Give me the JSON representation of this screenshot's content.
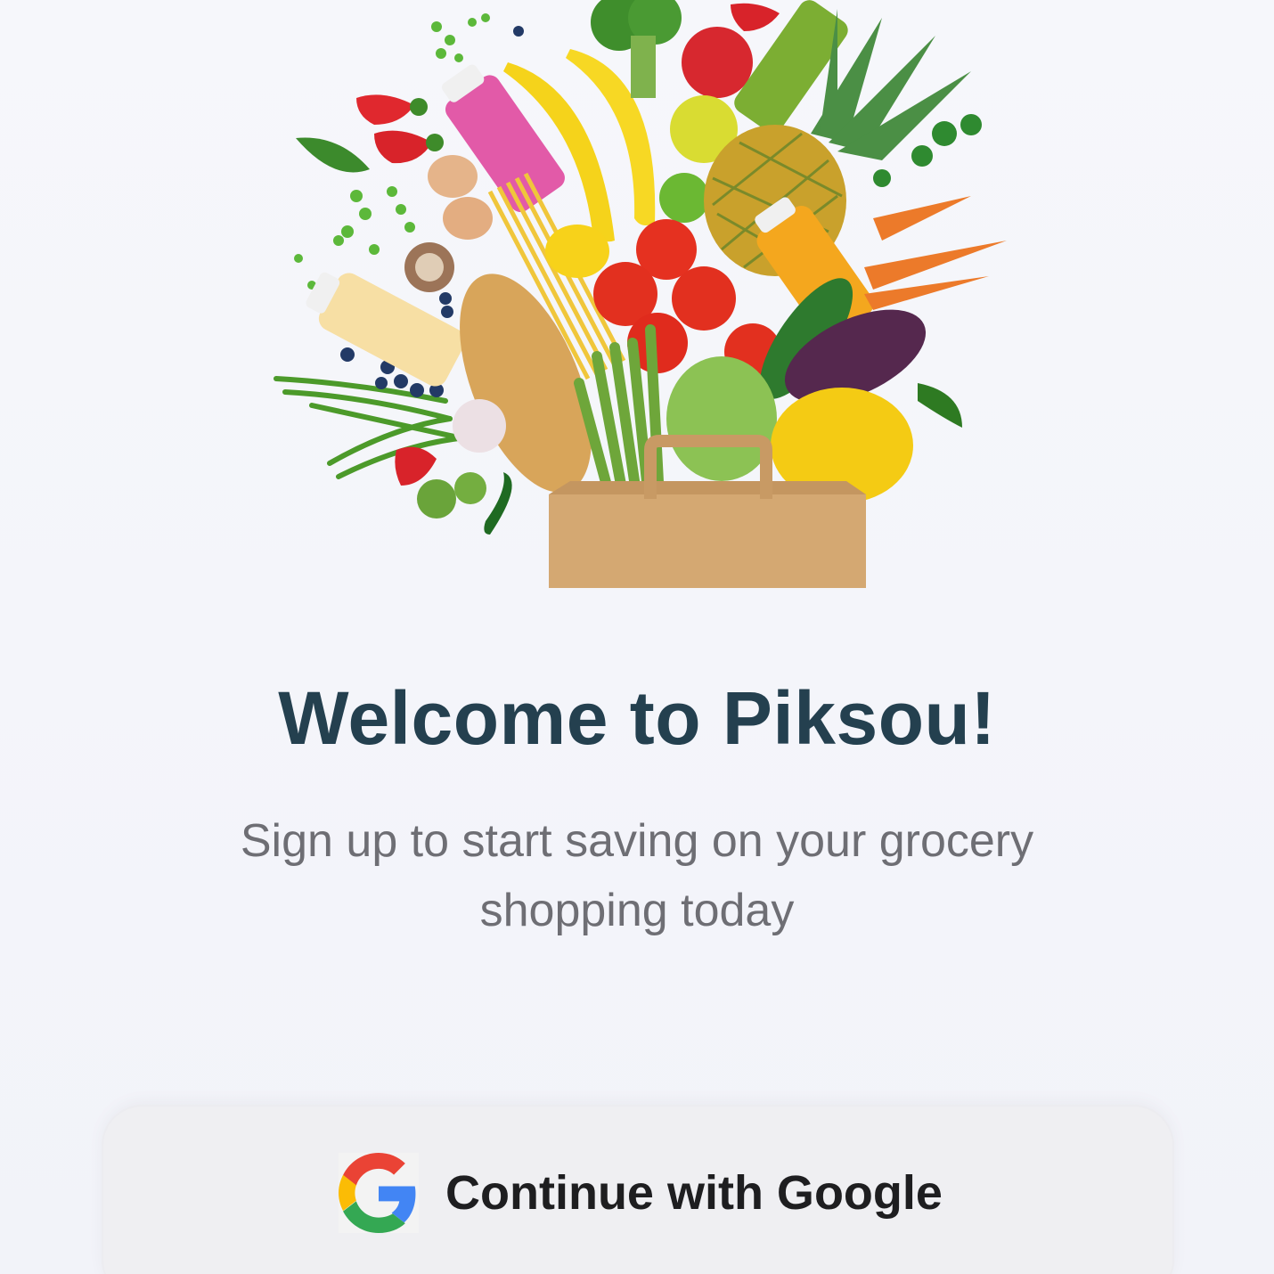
{
  "welcome": {
    "title": "Welcome to Piksou!",
    "subtitle": "Sign up to start saving on your grocery shopping today"
  },
  "auth": {
    "google_button_label": "Continue with Google",
    "google_icon": "google-g-logo"
  },
  "colors": {
    "background": "#f3f4f9",
    "title": "#24404f",
    "subtitle": "#6e6e74",
    "button_bg": "#efeff2",
    "button_text": "#1e1e20"
  }
}
